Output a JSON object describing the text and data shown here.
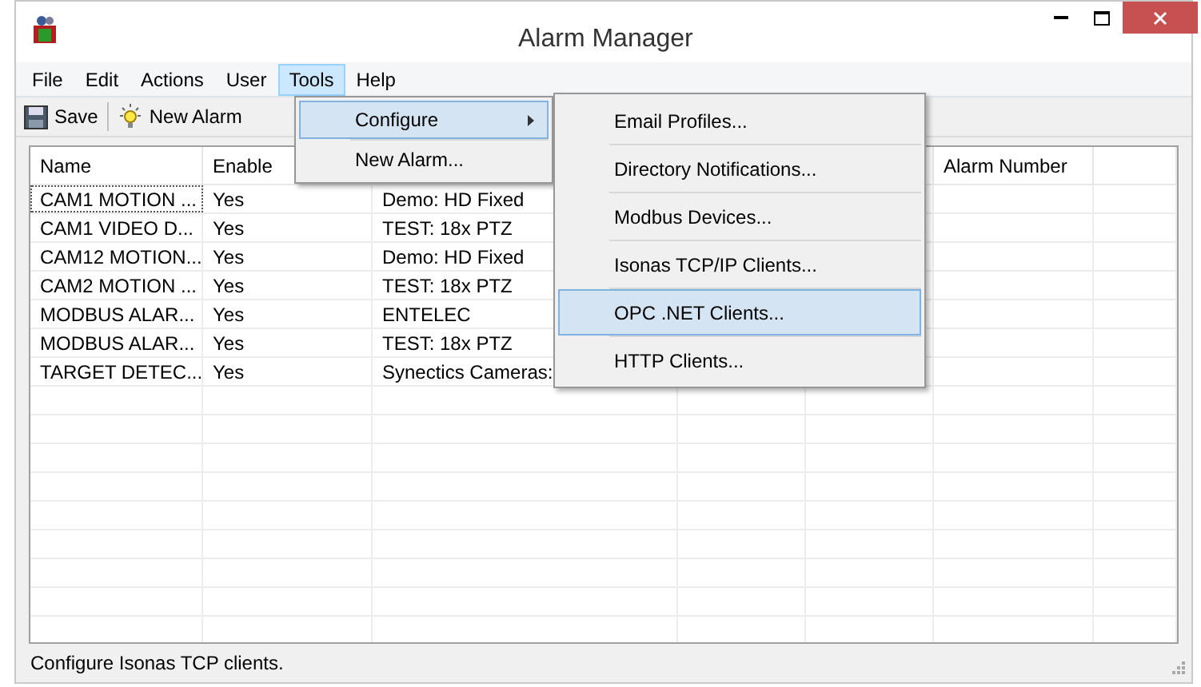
{
  "window": {
    "title": "Alarm Manager"
  },
  "menu_bar": [
    {
      "label": "File",
      "selected": false
    },
    {
      "label": "Edit",
      "selected": false
    },
    {
      "label": "Actions",
      "selected": false
    },
    {
      "label": "User",
      "selected": false
    },
    {
      "label": "Tools",
      "selected": true
    },
    {
      "label": "Help",
      "selected": false
    }
  ],
  "toolbar": [
    {
      "label": "Save",
      "kind": "save"
    },
    {
      "label": "New Alarm",
      "kind": "new"
    }
  ],
  "table": {
    "columns": [
      "Name",
      "Enable",
      "",
      "",
      "",
      "Alarm Number"
    ],
    "rows": [
      [
        "CAM1 MOTION ...",
        "Yes",
        "Demo: HD Fixed"
      ],
      [
        "CAM1 VIDEO D...",
        "Yes",
        "TEST: 18x PTZ"
      ],
      [
        "CAM12 MOTION...",
        "Yes",
        "Demo: HD Fixed"
      ],
      [
        "CAM2 MOTION ...",
        "Yes",
        "TEST: 18x PTZ"
      ],
      [
        "MODBUS ALAR...",
        "Yes",
        "ENTELEC"
      ],
      [
        "MODBUS ALAR...",
        "Yes",
        "TEST: 18x PTZ"
      ],
      [
        "TARGET DETEC...",
        "Yes",
        "Synectics Cameras:"
      ]
    ]
  },
  "tools_menu": [
    {
      "label": "Configure",
      "selected": true,
      "submenu": true
    },
    {
      "label": "New Alarm...",
      "selected": false,
      "submenu": false
    }
  ],
  "configure_menu": [
    {
      "label": "Email Profiles...",
      "selected": false
    },
    {
      "label": "Directory Notifications...",
      "selected": false
    },
    {
      "label": "Modbus Devices...",
      "selected": false
    },
    {
      "label": "Isonas TCP/IP Clients...",
      "selected": false
    },
    {
      "label": "OPC .NET Clients...",
      "selected": true
    },
    {
      "label": "HTTP Clients...",
      "selected": false
    }
  ],
  "status_bar": "Configure Isonas TCP clients."
}
